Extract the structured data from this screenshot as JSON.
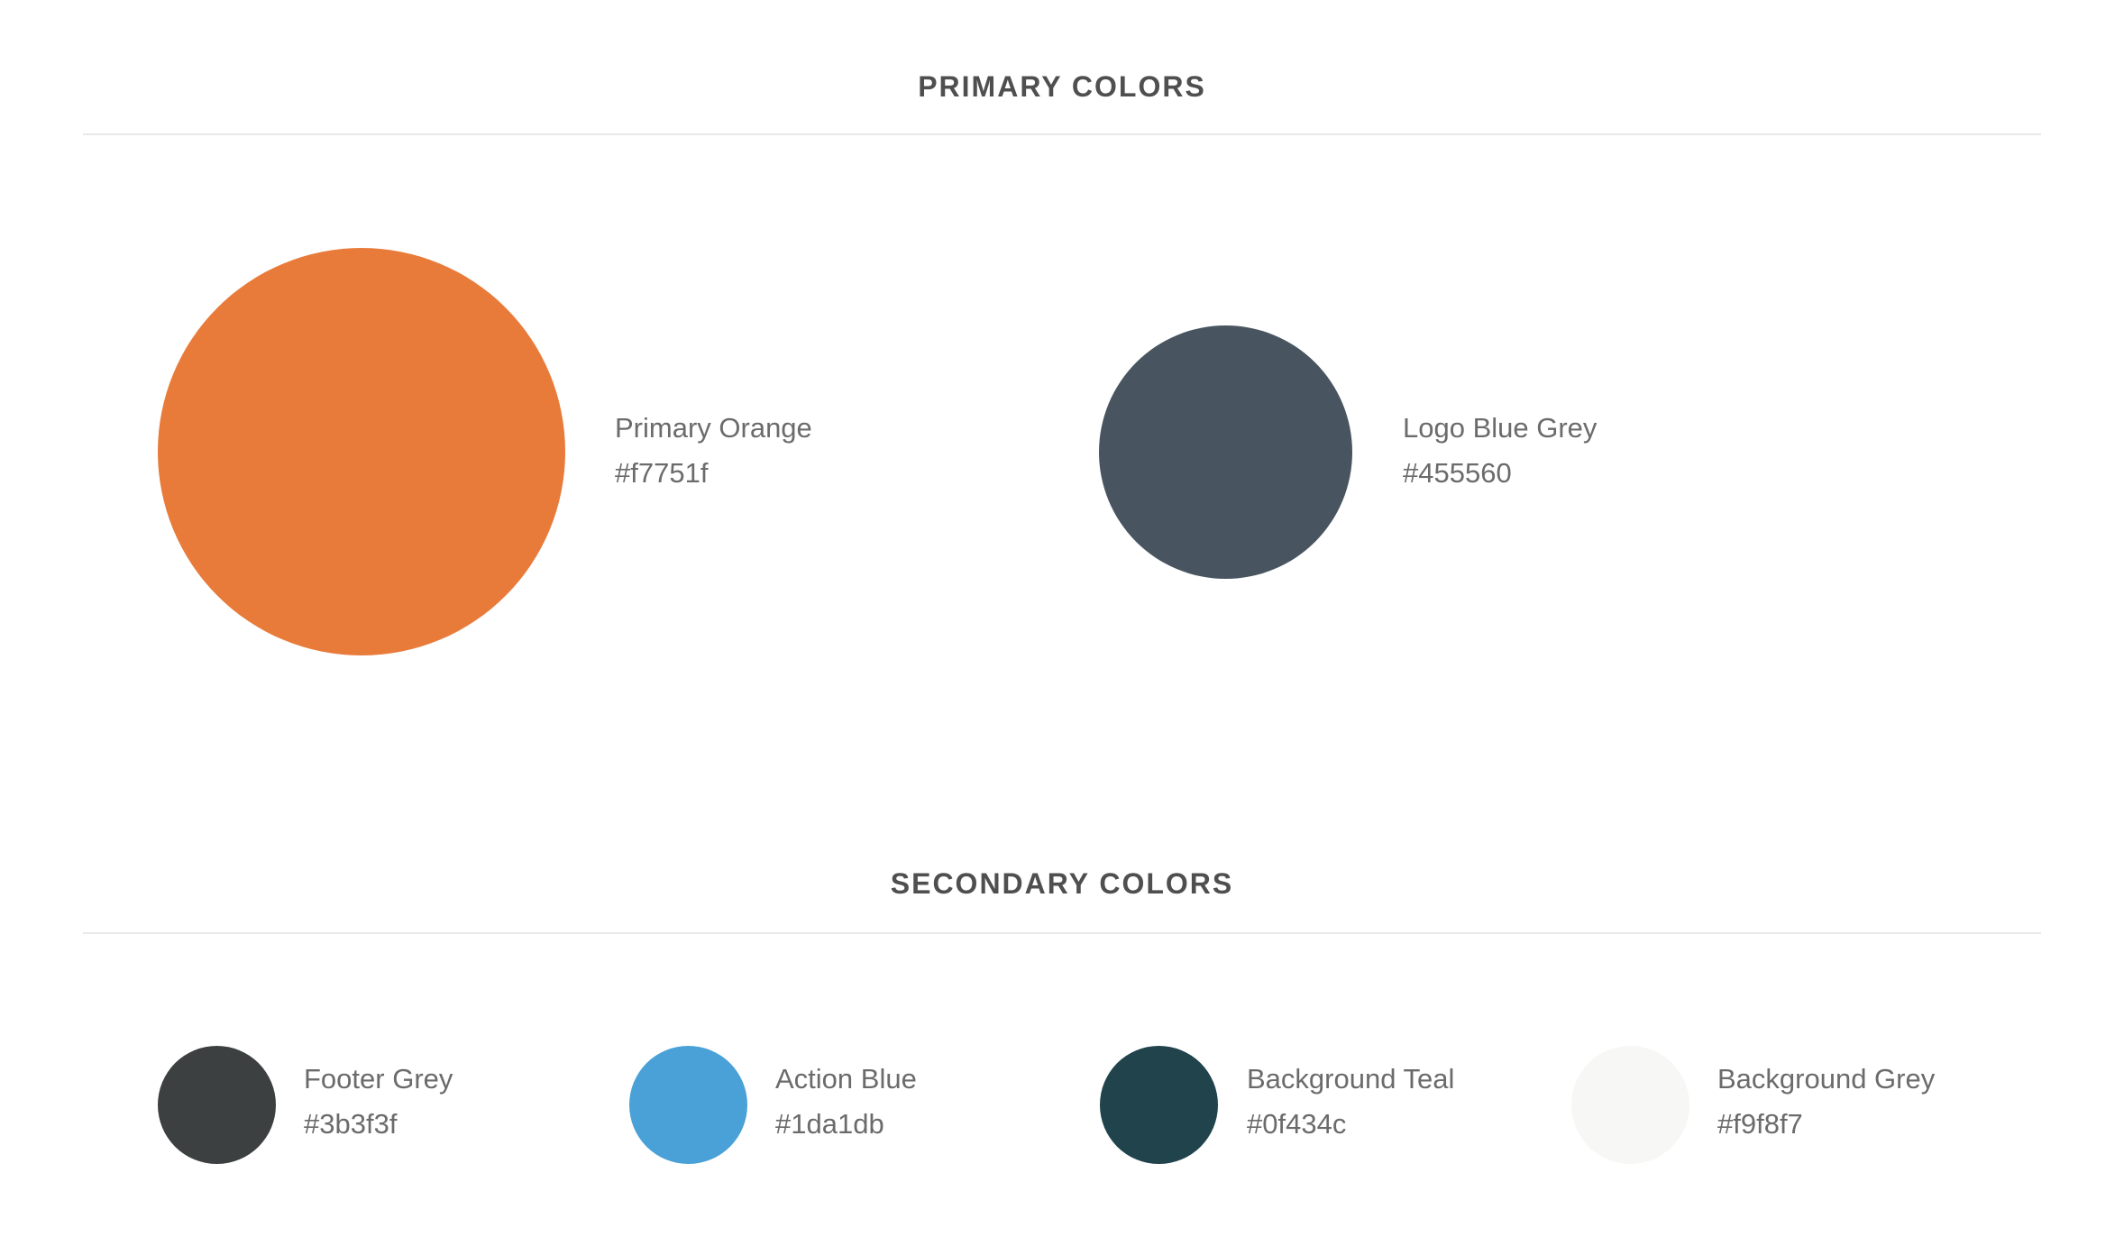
{
  "primary": {
    "title": "PRIMARY COLORS",
    "colors": [
      {
        "name": "Primary Orange",
        "hex": "#f7751f",
        "swatch": "#e87b3a"
      },
      {
        "name": "Logo Blue Grey",
        "hex": "#455560",
        "swatch": "#485560"
      }
    ]
  },
  "secondary": {
    "title": "SECONDARY COLORS",
    "colors": [
      {
        "name": "Footer Grey",
        "hex": "#3b3f3f",
        "swatch": "#3c4040"
      },
      {
        "name": "Action Blue",
        "hex": "#1da1db",
        "swatch": "#49a1d8"
      },
      {
        "name": "Background Teal",
        "hex": "#0f434c",
        "swatch": "#21434c"
      },
      {
        "name": "Background Grey",
        "hex": "#f9f8f7",
        "swatch": "#f7f7f6"
      }
    ]
  }
}
